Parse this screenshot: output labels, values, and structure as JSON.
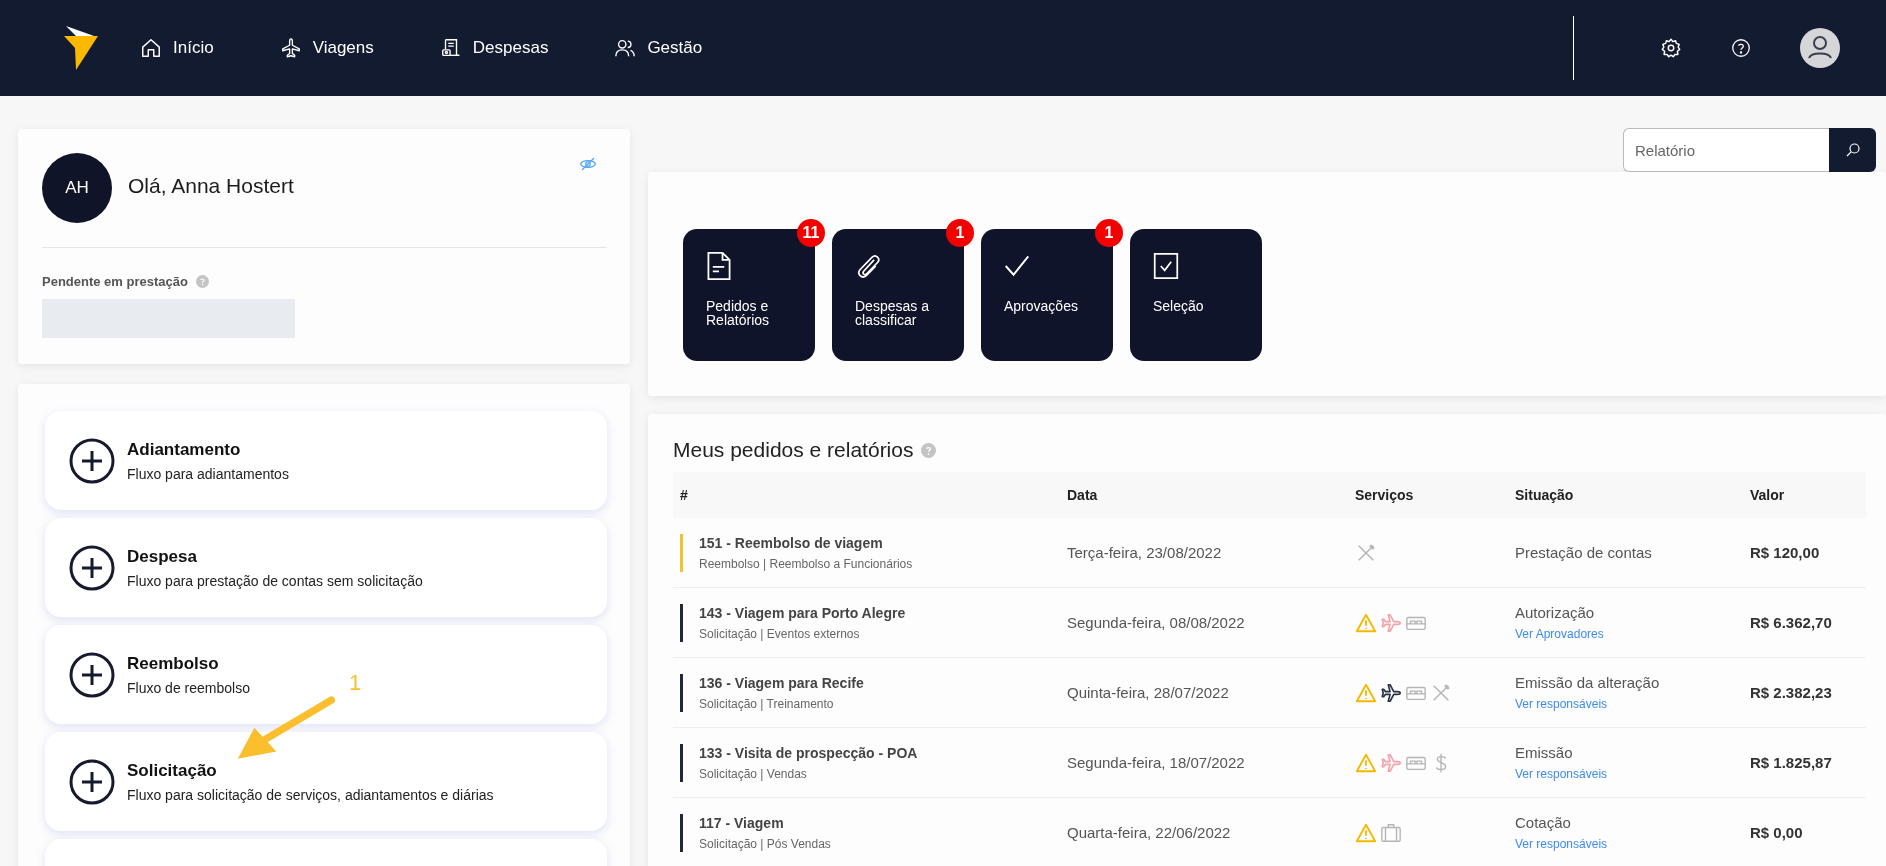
{
  "nav": {
    "items": [
      {
        "kind": "home",
        "label": "Início"
      },
      {
        "kind": "plane",
        "label": "Viagens"
      },
      {
        "kind": "receipt",
        "label": "Despesas"
      },
      {
        "kind": "people",
        "label": "Gestão"
      }
    ]
  },
  "profile": {
    "initials": "AH",
    "greeting": "Olá, Anna Hostert",
    "pending_label": "Pendente em prestação"
  },
  "search": {
    "placeholder": "Relatório"
  },
  "shortcuts": [
    {
      "kind": "document",
      "label": "Pedidos e Relatórios",
      "badge": "11"
    },
    {
      "kind": "clip",
      "label": "Despesas a classificar",
      "badge": "1"
    },
    {
      "kind": "check",
      "label": "Aprovações",
      "badge": "1"
    },
    {
      "kind": "checkbox",
      "label": "Seleção"
    }
  ],
  "flows": [
    {
      "title": "Adiantamento",
      "description": "Fluxo para adiantamentos"
    },
    {
      "title": "Despesa",
      "description": "Fluxo para prestação de contas sem solicitação"
    },
    {
      "title": "Reembolso",
      "description": "Fluxo de reembolso"
    },
    {
      "title": "Solicitação",
      "description": "Fluxo para solicitação de serviços, adiantamentos e diárias"
    }
  ],
  "annotation": {
    "label": "1"
  },
  "orders": {
    "title": "Meus pedidos e relatórios",
    "columns": [
      "#",
      "Data",
      "Serviços",
      "Situação",
      "Valor"
    ],
    "rows": [
      {
        "title": "151 - Reembolso de viagem",
        "subtitle": "Reembolso | Reembolso a Funcionários",
        "color": "#f5c12e",
        "date": "Terça-feira, 23/08/2022",
        "services": [
          {
            "kind": "meal",
            "color": "#b5b5b5"
          }
        ],
        "status": "Prestação de contas",
        "value": "R$ 120,00"
      },
      {
        "title": "143 - Viagem para Porto Alegre",
        "subtitle": "Solicitação | Eventos externos",
        "color": "#22273d",
        "date": "Segunda-feira, 08/08/2022",
        "services": [
          {
            "kind": "warning",
            "color": "#f5b800"
          },
          {
            "kind": "plane",
            "color": "#f4a3ab"
          },
          {
            "kind": "bed",
            "color": "#b5b5b5"
          }
        ],
        "status": "Autorização",
        "link": "Ver Aprovadores",
        "value": "R$ 6.362,70"
      },
      {
        "title": "136 - Viagem para Recife",
        "subtitle": "Solicitação | Treinamento",
        "color": "#22273d",
        "date": "Quinta-feira, 28/07/2022",
        "services": [
          {
            "kind": "warning",
            "color": "#f5b800"
          },
          {
            "kind": "plane",
            "color": "#2a3045"
          },
          {
            "kind": "bed",
            "color": "#b5b5b5"
          },
          {
            "kind": "meal",
            "color": "#b5b5b5"
          }
        ],
        "status": "Emissão da alteração",
        "link": "Ver responsáveis",
        "value": "R$ 2.382,23"
      },
      {
        "title": "133 - Visita de prospecção - POA",
        "subtitle": "Solicitação | Vendas",
        "color": "#22273d",
        "date": "Segunda-feira, 18/07/2022",
        "services": [
          {
            "kind": "warning",
            "color": "#f5b800"
          },
          {
            "kind": "plane",
            "color": "#f4a3ab"
          },
          {
            "kind": "bed",
            "color": "#b5b5b5"
          },
          {
            "kind": "money",
            "color": "#b5b5b5"
          }
        ],
        "status": "Emissão",
        "link": "Ver responsáveis",
        "value": "R$ 1.825,87"
      },
      {
        "title": "117 - Viagem",
        "subtitle": "Solicitação | Pós Vendas",
        "color": "#22273d",
        "date": "Quarta-feira, 22/06/2022",
        "services": [
          {
            "kind": "warning",
            "color": "#f5b800"
          },
          {
            "kind": "suitcase",
            "color": "#b5b5b5"
          }
        ],
        "status": "Cotação",
        "link": "Ver responsáveis",
        "value": "R$ 0,00"
      }
    ]
  }
}
